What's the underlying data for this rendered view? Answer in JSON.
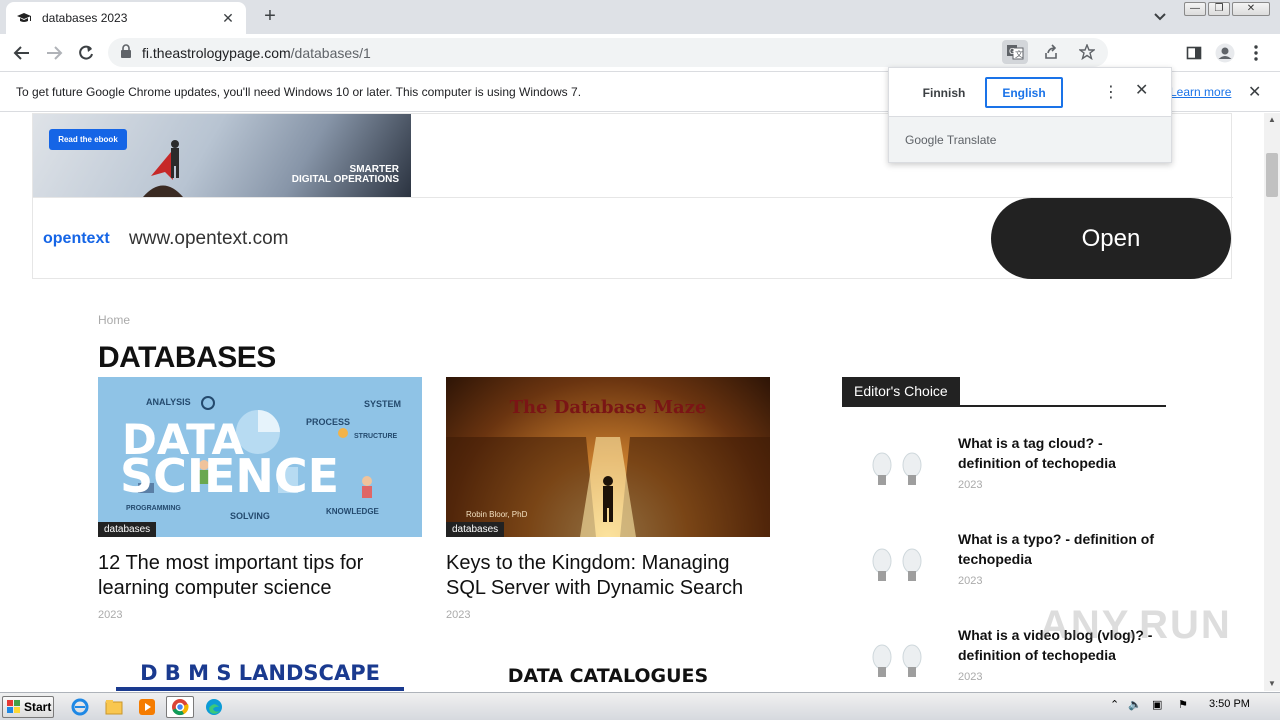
{
  "browser": {
    "tab_title": "databases 2023",
    "url_host": "fi.theastrologypage.com",
    "url_path": "/databases/1"
  },
  "infobar": {
    "message": "To get future Google Chrome updates, you'll need Windows 10 or later. This computer is using Windows 7.",
    "learn_more": "Learn more"
  },
  "translate_popup": {
    "source_lang": "Finnish",
    "target_lang": "English",
    "brand": "Google Translate"
  },
  "ad": {
    "read_button": "Read the ebook",
    "tagline_1": "SMARTER",
    "tagline_2": "DIGITAL OPERATIONS",
    "brand": "opentext",
    "url": "www.opentext.com",
    "open_button": "Open"
  },
  "page": {
    "breadcrumb": "Home",
    "heading": "DATABASES"
  },
  "cards": [
    {
      "category": "databases",
      "title": "12 The most important tips for learning computer science",
      "date": "2023",
      "img_text": {
        "data": "DATA",
        "science": "SCIENCE",
        "analysis": "ANALYSIS",
        "system": "SYSTEM",
        "process": "PROCESS",
        "structure": "STRUCTURE",
        "solving": "SOLVING",
        "knowledge": "KNOWLEDGE",
        "programming": "PROGRAMMING"
      }
    },
    {
      "category": "databases",
      "title": "Keys to the Kingdom: Managing SQL Server with Dynamic Search",
      "date": "2023",
      "img_text": {
        "title": "The Database Maze",
        "author": "Robin Bloor, PhD"
      }
    }
  ],
  "bottom_cards": [
    {
      "title": "D B M S  LANDSCAPE"
    },
    {
      "title": "DATA  CATALOGUES"
    }
  ],
  "sidebar": {
    "heading": "Editor's Choice",
    "items": [
      {
        "title": "What is a tag cloud? - definition of techopedia",
        "date": "2023"
      },
      {
        "title": "What is a typo? - definition of techopedia",
        "date": "2023"
      },
      {
        "title": "What is a video blog (vlog)? - definition of techopedia",
        "date": "2023"
      }
    ]
  },
  "taskbar": {
    "start_label": "Start",
    "clock": "3:50 PM"
  },
  "watermark": "ANY.RUN",
  "colors": {
    "accent_blue": "#1a73e8",
    "brand_blue": "#1565e6",
    "dark": "#222222"
  }
}
